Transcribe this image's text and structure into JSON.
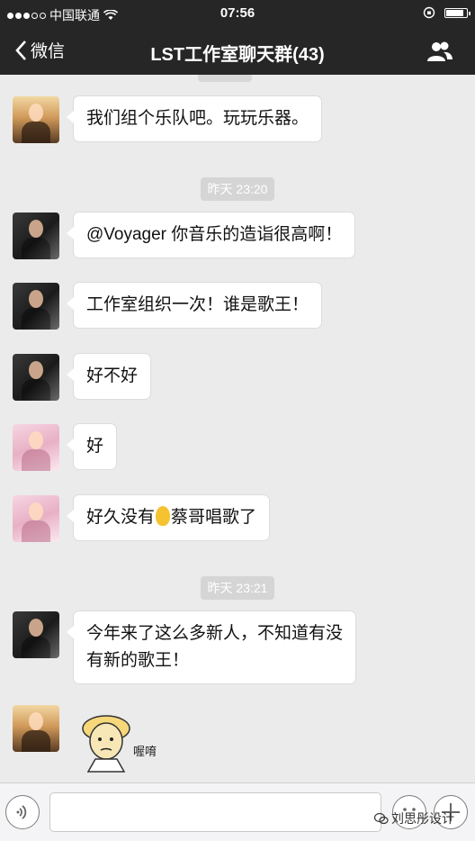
{
  "status_bar": {
    "carrier": "中国联通",
    "time": "07:56",
    "battery_level": 0.9
  },
  "navbar": {
    "back_label": "微信",
    "title": "LST工作室聊天群(43)"
  },
  "messages": [
    {
      "avatar": "sun",
      "text": "我们组个乐队吧。玩玩乐器。"
    },
    {
      "timestamp": "昨天 23:20"
    },
    {
      "avatar": "man",
      "text": "@Voyager 你音乐的造诣很高啊！"
    },
    {
      "avatar": "man",
      "text": "工作室组织一次！谁是歌王！"
    },
    {
      "avatar": "man",
      "text": "好不好"
    },
    {
      "avatar": "girl",
      "text": "好"
    },
    {
      "avatar": "girl",
      "text_before": "好久没有",
      "emoji": "ear-emoji",
      "text_after": "蔡哥唱歌了"
    },
    {
      "timestamp": "昨天 23:21"
    },
    {
      "avatar": "man",
      "text_line1": "今年来了这么多新人，不知道有没",
      "text_line2": "有新的歌王！"
    },
    {
      "avatar": "sun",
      "sticker": "cartoon-sticker",
      "sticker_text": "喔唷"
    }
  ],
  "input_bar": {
    "voice_icon": "voice-icon",
    "emoji_icon": "smiley-icon",
    "add_icon": "plus-icon",
    "value": ""
  },
  "watermark": {
    "text": "刘思彤设计"
  }
}
